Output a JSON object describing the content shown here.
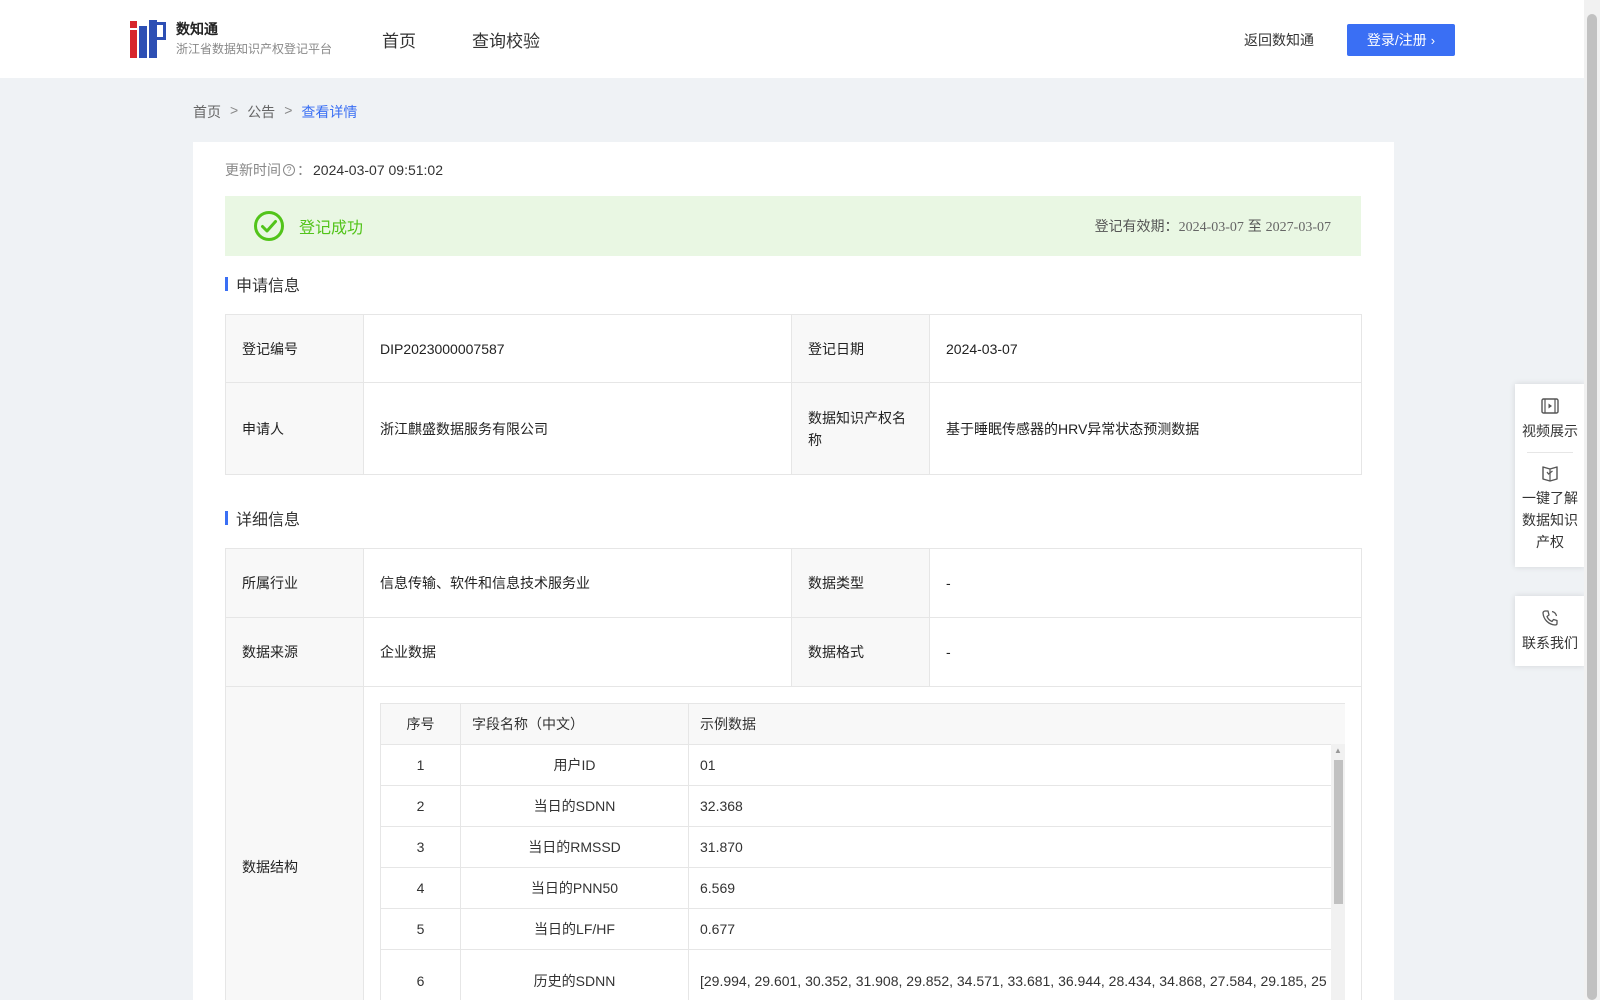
{
  "header": {
    "brand_name": "数知通",
    "brand_subtitle": "浙江省数据知识产权登记平台",
    "nav": [
      "首页",
      "查询校验"
    ],
    "back_link": "返回数知通",
    "login_label": "登录/注册"
  },
  "breadcrumb": [
    "首页",
    "公告",
    "查看详情"
  ],
  "update": {
    "label": "更新时间",
    "value": "2024-03-07 09:51:02"
  },
  "status": {
    "label": "登记成功",
    "validity_label": "登记有效期：",
    "validity_from": "2024-03-07",
    "validity_sep": "至",
    "validity_to": "2027-03-07",
    "color": "#52c41a"
  },
  "application": {
    "title": "申请信息",
    "rows": [
      {
        "l1": "登记编号",
        "v1": "DIP2023000007587",
        "l2": "登记日期",
        "v2": "2024-03-07"
      },
      {
        "l1": "申请人",
        "v1": "浙江麒盛数据服务有限公司",
        "l2": "数据知识产权名称",
        "v2": "基于睡眠传感器的HRV异常状态预测数据"
      }
    ]
  },
  "details": {
    "title": "详细信息",
    "rows": [
      {
        "l1": "所属行业",
        "v1": "信息传输、软件和信息技术服务业",
        "l2": "数据类型",
        "v2": "-"
      },
      {
        "l1": "数据来源",
        "v1": "企业数据",
        "l2": "数据格式",
        "v2": "-"
      }
    ],
    "structure_label": "数据结构",
    "structure": {
      "headers": [
        "序号",
        "字段名称（中文）",
        "示例数据"
      ],
      "rows": [
        {
          "no": "1",
          "name": "用户ID",
          "sample": "01"
        },
        {
          "no": "2",
          "name": "当日的SDNN",
          "sample": "32.368"
        },
        {
          "no": "3",
          "name": "当日的RMSSD",
          "sample": "31.870"
        },
        {
          "no": "4",
          "name": "当日的PNN50",
          "sample": "6.569"
        },
        {
          "no": "5",
          "name": "当日的LF/HF",
          "sample": "0.677"
        },
        {
          "no": "6",
          "name": "历史的SDNN",
          "sample": "[29.994, 29.601, 30.352, 31.908, 29.852, 34.571, 33.681, 36.944, 28.434, 34.868, 27.584, 29.185, 25"
        }
      ]
    }
  },
  "float_panel": {
    "video": "视频展示",
    "learn": "一键了解数据知识产权",
    "contact": "联系我们"
  },
  "colors": {
    "accent": "#3a6ff4",
    "success_bg": "#e9f7e3",
    "page_bg": "#eff2f5"
  }
}
